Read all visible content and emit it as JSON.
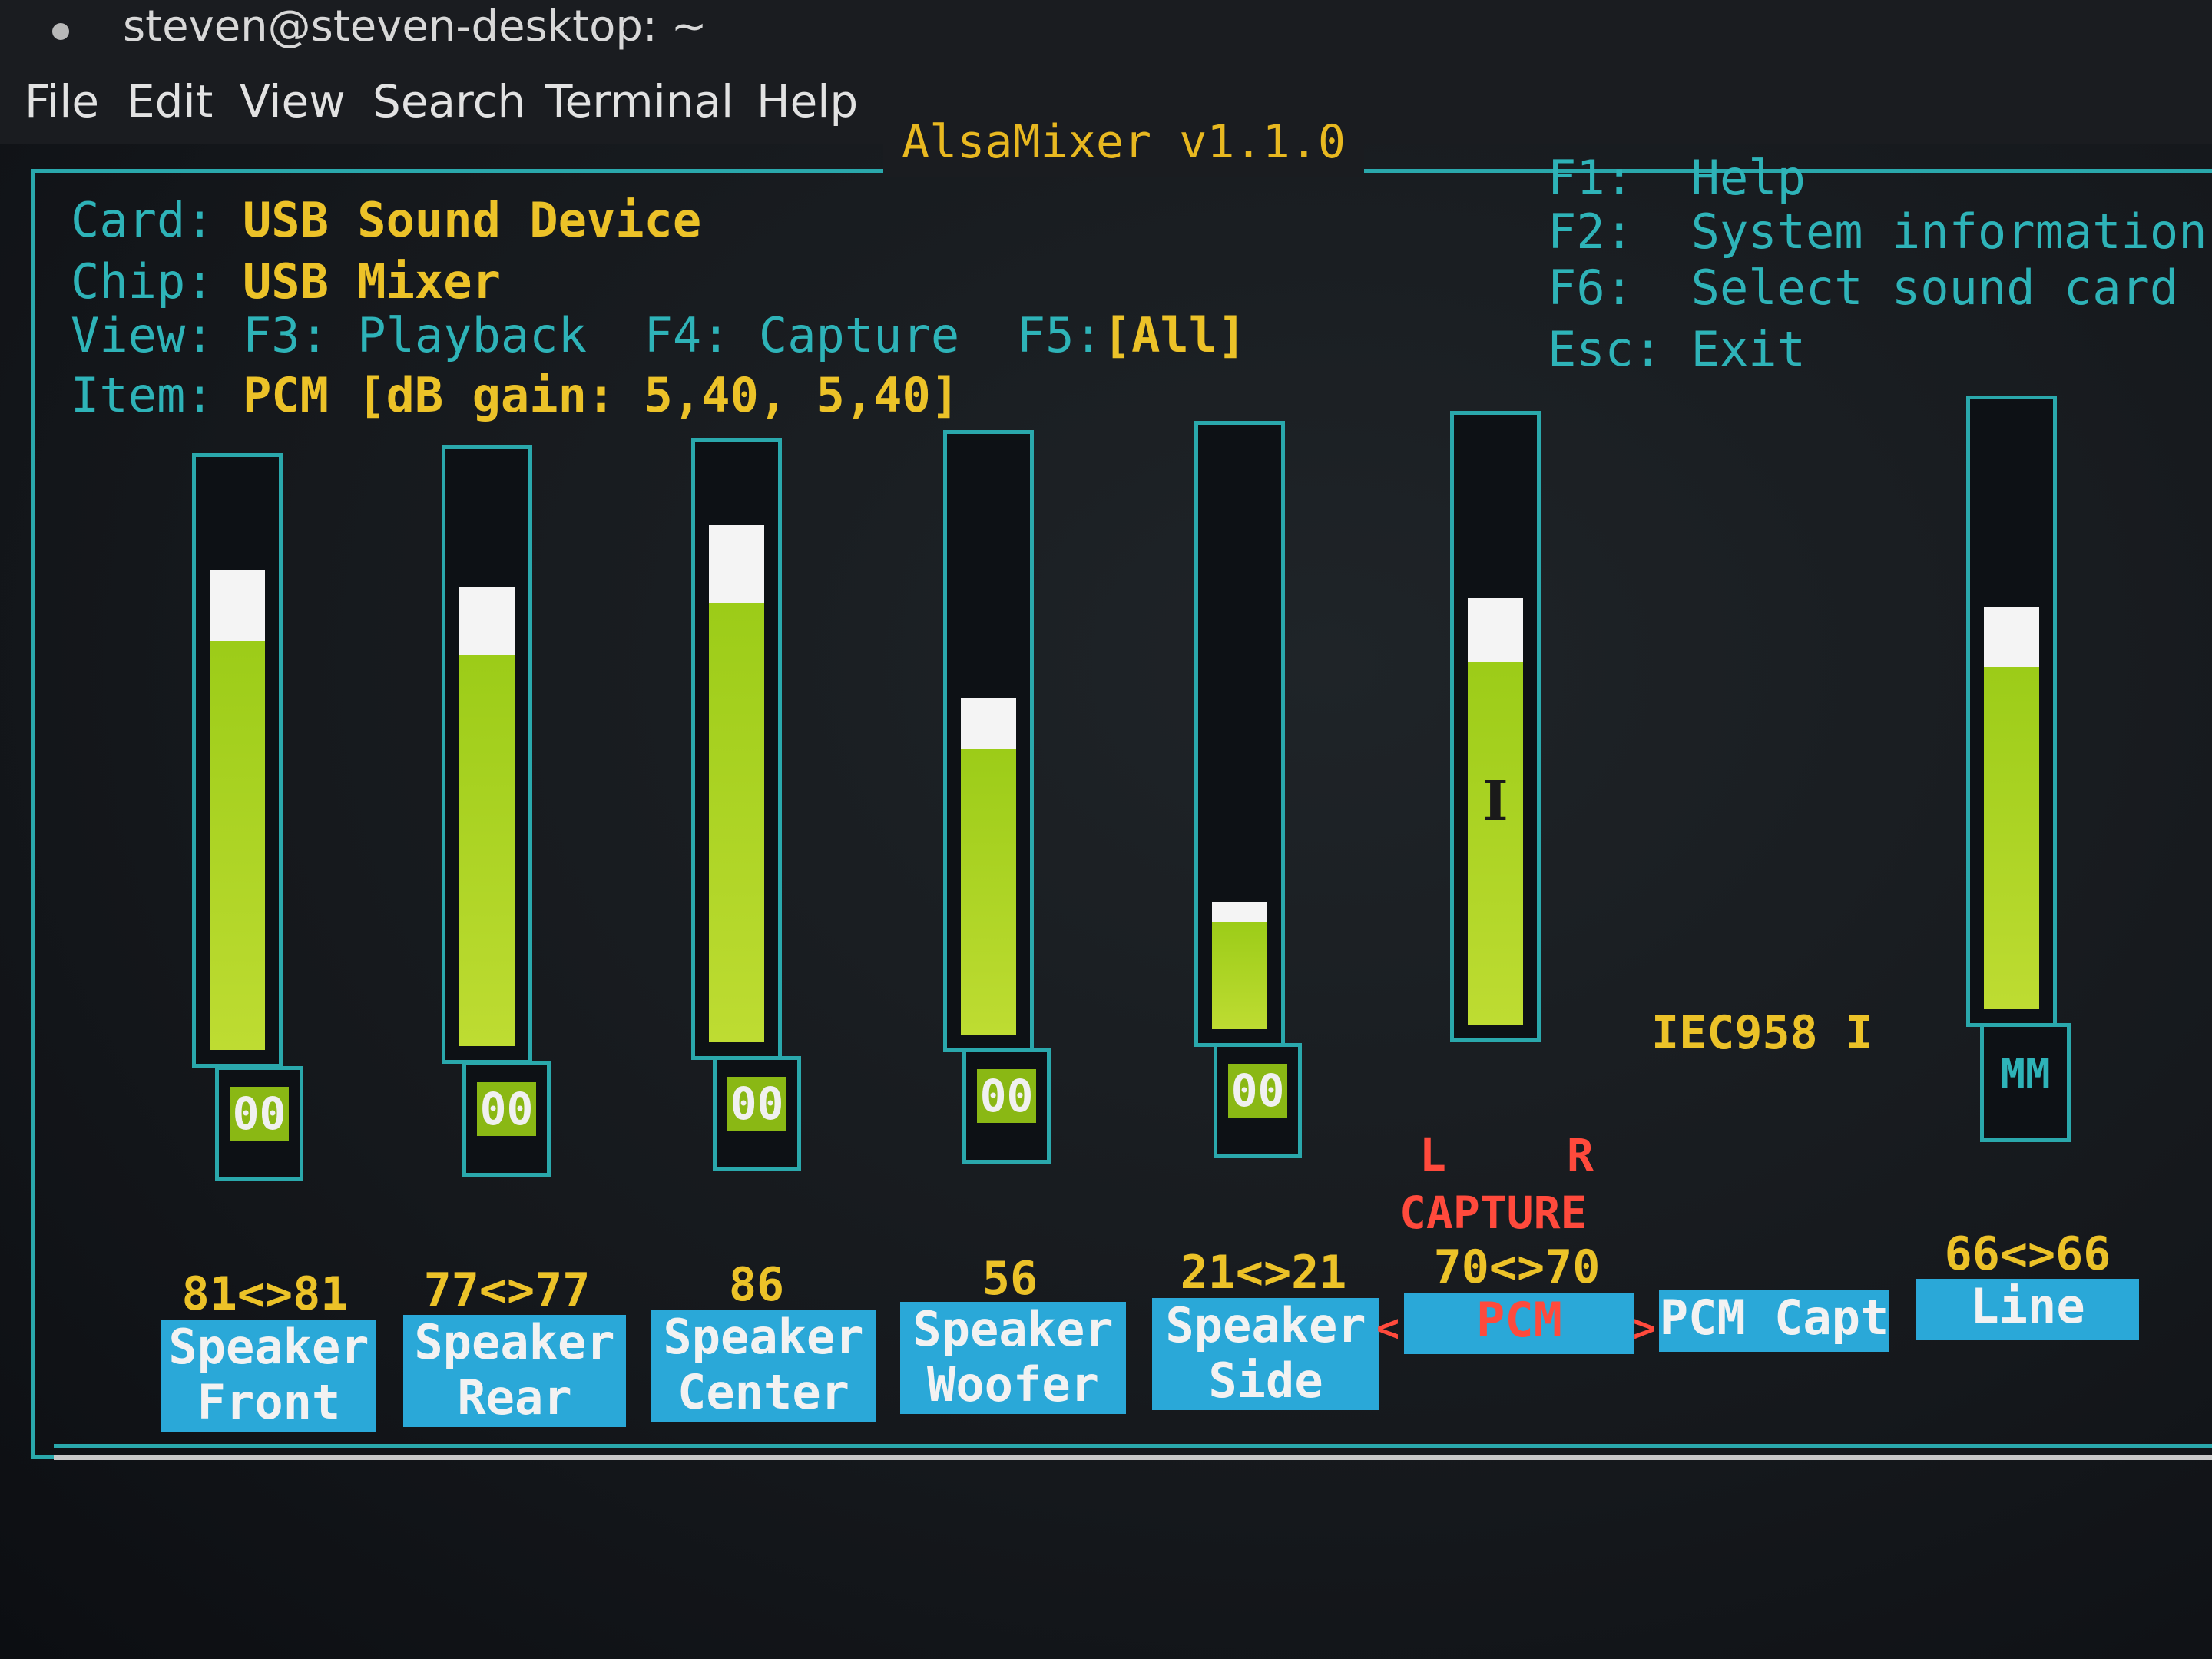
{
  "window": {
    "title": "steven@steven-desktop: ~"
  },
  "menu": [
    {
      "label": "File"
    },
    {
      "label": "Edit"
    },
    {
      "label": "View"
    },
    {
      "label": "Search"
    },
    {
      "label": "Terminal"
    },
    {
      "label": "Help"
    }
  ],
  "app_title": "AlsaMixer v1.1.0",
  "info": {
    "card_label": "Card:",
    "card_value": "USB Sound Device",
    "chip_label": "Chip:",
    "chip_value": "USB Mixer",
    "view_label": "View:",
    "view_playback": "F3: Playback",
    "view_capture": "F4: Capture",
    "view_all_key": "F5:",
    "view_all": "[All]",
    "item_label": "Item:",
    "item_value": "PCM [dB gain: 5,40, 5,40]"
  },
  "keys": [
    {
      "key": "F1:",
      "action": "Help"
    },
    {
      "key": "F2:",
      "action": "System information"
    },
    {
      "key": "F6:",
      "action": "Select sound card"
    },
    {
      "key": "Esc:",
      "action": "Exit"
    }
  ],
  "channels": [
    {
      "name": "Speaker\nFront",
      "value": "81<>81",
      "level": 0.81,
      "mute": "00"
    },
    {
      "name": "Speaker\nRear",
      "value": "77<>77",
      "level": 0.77,
      "mute": "00"
    },
    {
      "name": "Speaker\nCenter",
      "value": "86",
      "level": 0.86,
      "mute": "00"
    },
    {
      "name": "Speaker\nWoofer",
      "value": "56",
      "level": 0.56,
      "mute": "00"
    },
    {
      "name": "Speaker\nSide",
      "value": "21<>21",
      "level": 0.21,
      "mute": "00"
    },
    {
      "name": "PCM",
      "value": "70<>70",
      "level": 0.7,
      "selected": true
    },
    {
      "name": "PCM Capt"
    },
    {
      "name": "Line",
      "value": "66<>66",
      "level": 0.66,
      "mute": "MM"
    }
  ],
  "capture": {
    "left": "L",
    "right": "R",
    "label": "CAPTURE"
  },
  "iec958": "IEC958 I",
  "colors": {
    "frame": "#2aa8ac",
    "accent_yellow": "#ecc228",
    "label_cyan": "#2eb3b8",
    "bar_green": "#9ccc18",
    "selected_red": "#ff4a3c"
  }
}
